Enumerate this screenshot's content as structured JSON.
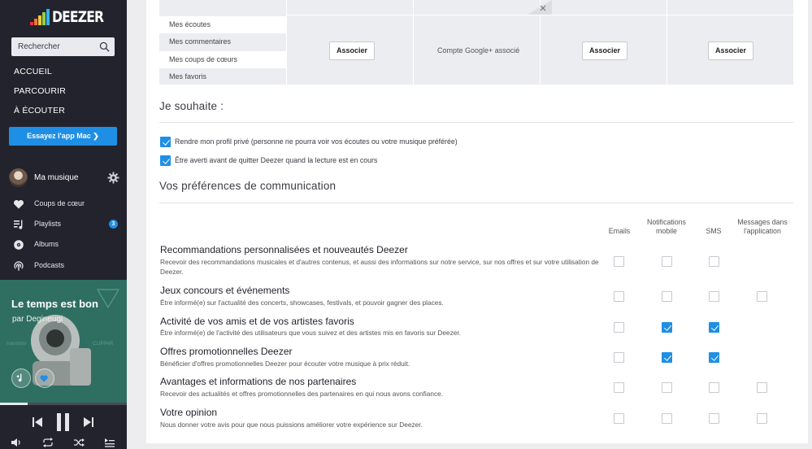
{
  "sidebar": {
    "logo_text": "DEEZER",
    "search_placeholder": "Rechercher",
    "nav": [
      "ACCUEIL",
      "PARCOURIR",
      "À ÉCOUTER"
    ],
    "try_app": "Essayez l'app Mac ❯",
    "my_music": "Ma musique",
    "items": [
      {
        "label": "Coups de cœur",
        "icon": "heart-icon"
      },
      {
        "label": "Playlists",
        "icon": "playlist-icon",
        "badge": "3"
      },
      {
        "label": "Albums",
        "icon": "album-icon"
      },
      {
        "label": "Podcasts",
        "icon": "podcast-icon"
      }
    ],
    "now_playing": {
      "title": "Le temps est bon",
      "artist": "par Degineugi",
      "progress": 0.22
    }
  },
  "accounts": {
    "permissions": [
      "Mes écoutes",
      "Mes commentaires",
      "Mes coups de cœurs",
      "Mes favoris"
    ],
    "associate_label": "Associer",
    "google_status": "Compte Google+ associé"
  },
  "wishes": {
    "heading": "Je souhaite :",
    "options": [
      {
        "label": "Rendre mon profil privé (personne ne pourra voir vos écoutes ou votre musique préférée)",
        "checked": true
      },
      {
        "label": "Être averti avant de quitter Deezer quand la lecture est en cours",
        "checked": true
      }
    ]
  },
  "communication": {
    "heading": "Vos préférences de communication",
    "columns": [
      "Emails",
      "Notifications mobile",
      "SMS",
      "Messages dans l'application"
    ],
    "rows": [
      {
        "title": "Recommandations personnalisées et nouveautés Deezer",
        "desc": "Recevoir des recommandations musicales et d'autres contenus, et aussi des informations sur notre service, sur nos offres et sur votre utilisation de Deezer.",
        "checks": [
          false,
          false,
          false,
          null
        ]
      },
      {
        "title": "Jeux concours et événements",
        "desc": "Être informé(e) sur l'actualité des concerts, showcases, festivals, et pouvoir gagner des places.",
        "checks": [
          false,
          false,
          false,
          false
        ]
      },
      {
        "title": "Activité de vos amis et de vos artistes favoris",
        "desc": "Être informé(e) de l'activité des utilisateurs que vous suivez et des artistes mis en favoris sur Deezer.",
        "checks": [
          false,
          true,
          true,
          null
        ]
      },
      {
        "title": "Offres promotionnelles Deezer",
        "desc": "Bénéficier d'offres promotionnelles Deezer pour écouter votre musique à prix réduit.",
        "checks": [
          false,
          true,
          true,
          null
        ]
      },
      {
        "title": "Avantages et informations de nos partenaires",
        "desc": "Recevoir des actualités et offres promotionnelles des partenaires en qui nous avons confiance.",
        "checks": [
          false,
          false,
          false,
          false
        ]
      },
      {
        "title": "Votre opinion",
        "desc": "Nous donner votre avis pour que nous puissions améliorer votre expérience sur Deezer.",
        "checks": [
          false,
          false,
          false,
          false
        ]
      }
    ]
  },
  "colors": {
    "accent": "#1f8fe5",
    "sidebar": "#23232d",
    "panel": "#ecedf0"
  }
}
